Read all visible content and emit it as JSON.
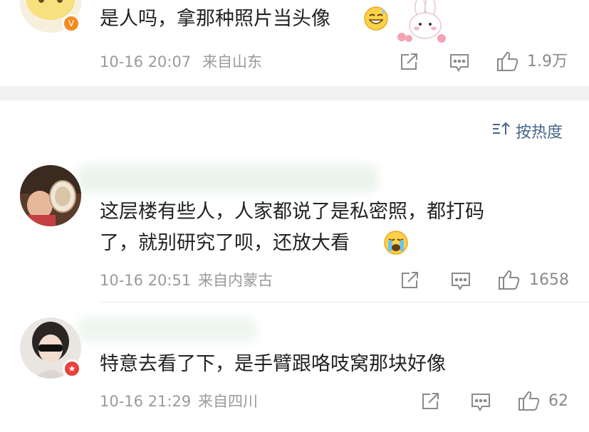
{
  "comments": [
    {
      "text": "是人吗，拿那种照片当头像",
      "time": "10-16 20:07",
      "location": "来自山东",
      "likes": "1.9万",
      "emoji": "grinning-sweat-emoji",
      "sticker": "bunny-sticker",
      "badge_color": "#f28c1f",
      "badge_icon": "verified-v-badge-icon"
    },
    {
      "text_lines": [
        "这层楼有些人，人家都说了是私密照，都打码",
        "了，就别研究了呗，还放大看"
      ],
      "time": "10-16 20:51",
      "location": "来自内蒙古",
      "likes": "1658",
      "emoji": "crying-face-emoji"
    },
    {
      "text": "特意去看了下，是手臂跟咯吱窝那块好像",
      "time": "10-16 21:29",
      "location": "来自四川",
      "likes": "62",
      "badge_color": "#e8413b",
      "badge_icon": "star-badge-icon"
    }
  ],
  "sort": {
    "label": "按热度",
    "icon": "sort-icon"
  },
  "actions": {
    "icons": [
      "share-icon",
      "comment-icon",
      "like-icon"
    ]
  },
  "colors": {
    "link_blue": "#47658a",
    "meta_gray": "#9a9a9a",
    "text": "#222222"
  }
}
